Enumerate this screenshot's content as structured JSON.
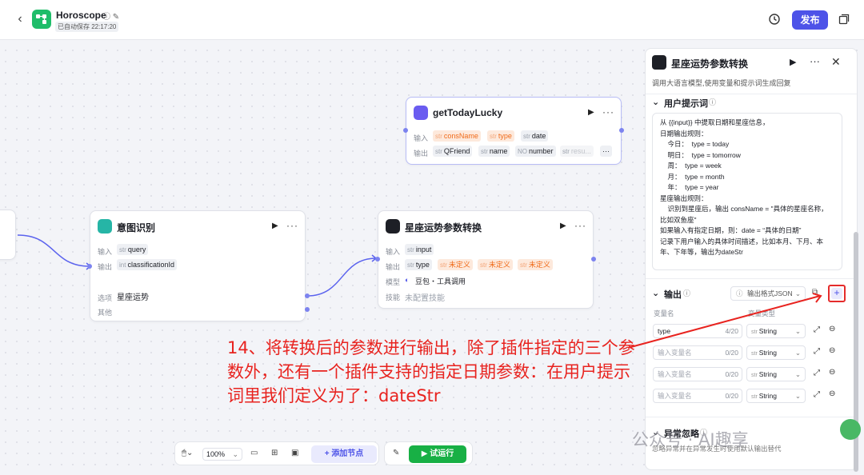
{
  "topbar": {
    "app_title": "Horoscope",
    "autosave": "已自动保存 22:17:20",
    "publish_label": "发布"
  },
  "nodes": {
    "getTodayLucky": {
      "title": "getTodayLucky",
      "input_label": "输入",
      "output_label": "输出",
      "inputs": [
        {
          "type": "str",
          "name": "consName",
          "warn": true
        },
        {
          "type": "str",
          "name": "type",
          "warn": true
        },
        {
          "type": "str",
          "name": "date",
          "warn": false
        }
      ],
      "outputs": [
        {
          "type": "str",
          "name": "QFriend"
        },
        {
          "type": "str",
          "name": "name"
        },
        {
          "type": "NO",
          "name": "number"
        },
        {
          "type": "str",
          "name": "resu..."
        }
      ]
    },
    "intent": {
      "title": "意图识别",
      "input_label": "输入",
      "output_label": "输出",
      "input": {
        "type": "str",
        "name": "query"
      },
      "output": {
        "type": "int",
        "name": "classificationId"
      },
      "option_label": "选项",
      "option_value": "星座运势",
      "other_label": "其他"
    },
    "convert": {
      "title": "星座运势参数转换",
      "input_label": "输入",
      "output_label": "输出",
      "model_label": "模型",
      "skill_label": "技能",
      "input": {
        "type": "str",
        "name": "input"
      },
      "output_type": {
        "type": "str",
        "name": "type"
      },
      "undefined_label": "未定义",
      "model_value": "豆包・工具调用",
      "skill_value": "未配置技能"
    }
  },
  "panel": {
    "title": "星座运势参数转换",
    "description": "调用大语言模型,使用变量和提示词生成回复",
    "prompt_section": "用户提示词",
    "prompt_lines": [
      "从 {{input}} 中提取日期和星座信息，",
      "日期输出规则：",
      "    今日：  type = today",
      "    明日：  type = tomorrow",
      "    周：  type = week",
      "    月：  type = month",
      "    年：  type = year",
      "星座输出规则：",
      "    识别到星座后，输出 consName = \"具体的星座名称，",
      "比如双鱼座\"",
      "如果输入有指定日期，则：date = “具体的日期”",
      "记录下用户输入的具体时间描述，比如本月、下月、本",
      "年、下年等，输出为dateStr"
    ],
    "output_section": "输出",
    "output_format": "输出格式JSON",
    "col_var_name": "变量名",
    "col_var_type": "变量类型",
    "rows": [
      {
        "value": "type",
        "placeholder": "",
        "count": "4/20",
        "type": "String"
      },
      {
        "value": "",
        "placeholder": "输入变量名",
        "count": "0/20",
        "type": "String"
      },
      {
        "value": "",
        "placeholder": "输入变量名",
        "count": "0/20",
        "type": "String"
      },
      {
        "value": "",
        "placeholder": "输入变量名",
        "count": "0/20",
        "type": "String"
      }
    ],
    "exception_section": "异常忽略",
    "exception_desc": "忽略异常并在异常发生时使用默认输出替代"
  },
  "bottom": {
    "zoom": "100%",
    "add_node": "添加节点",
    "test_run": "试运行"
  },
  "annotation": "14、将转换后的参数进行输出，除了插件指定的三个参数外，还有一个插件支持的指定日期参数：在用户提示词里我们定义为了：dateStr",
  "watermark": "公众号 · AI趣享",
  "colors": {
    "accent": "#4d53e8",
    "brand": "#1fbd6a",
    "warn": "#f06b1a",
    "run": "#18b045",
    "annotation": "#e8231f"
  }
}
